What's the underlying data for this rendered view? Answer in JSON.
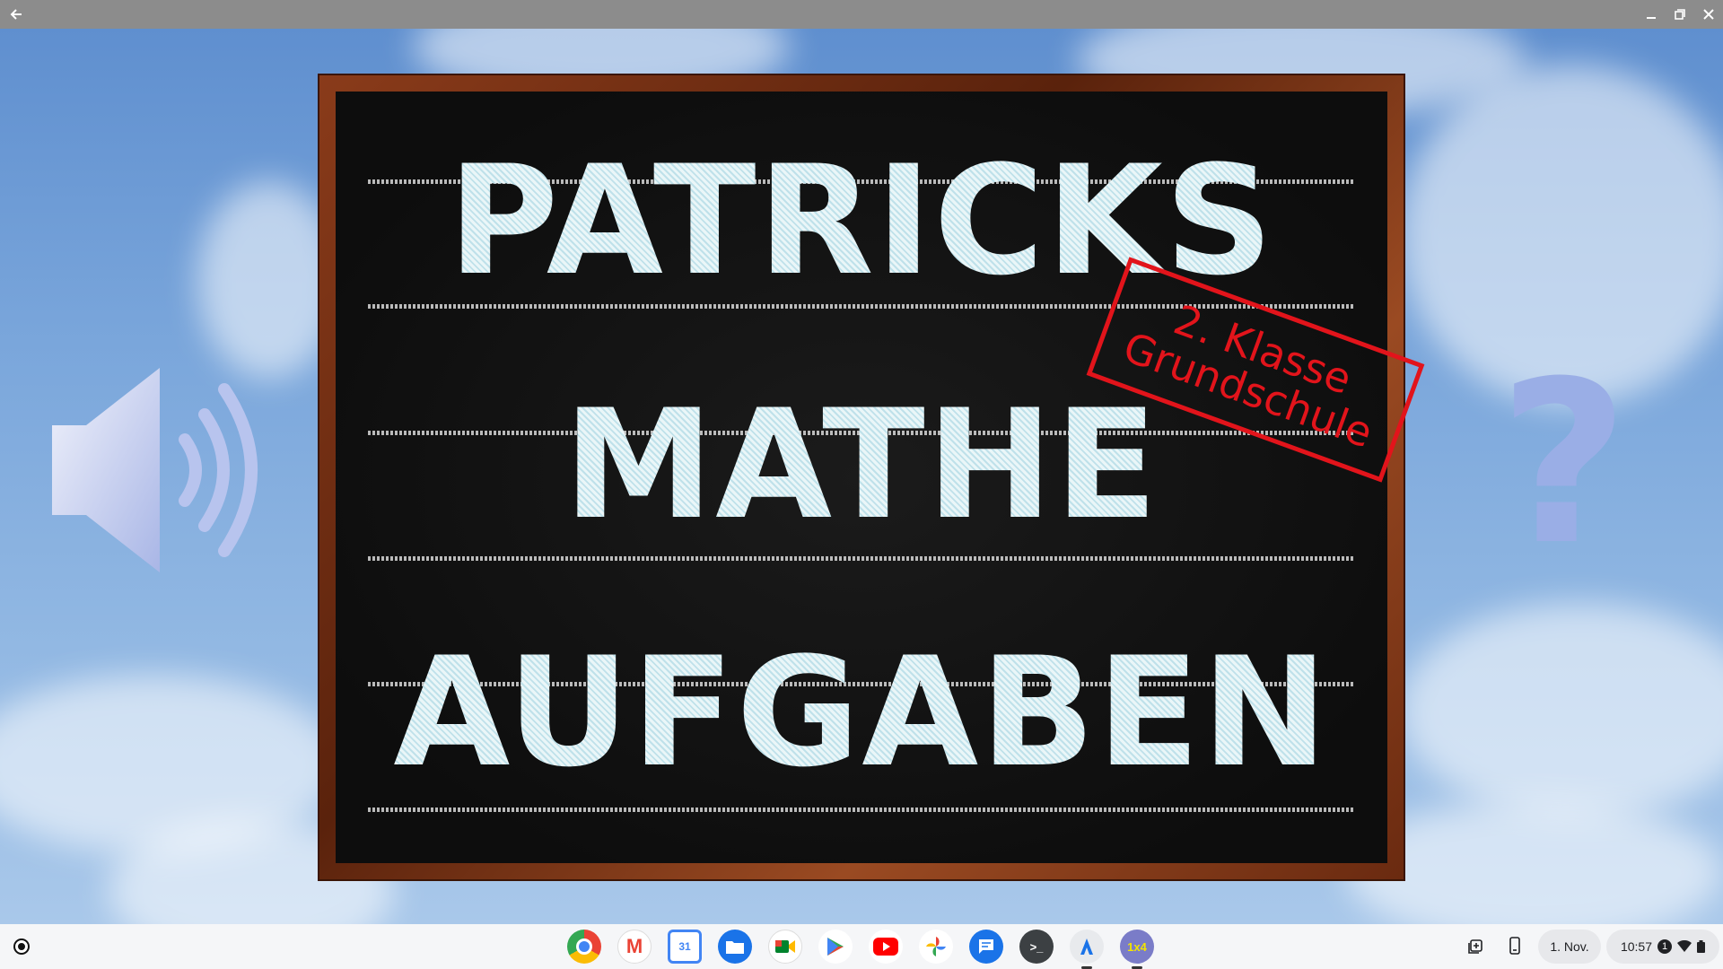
{
  "window": {
    "back_icon": "arrow-left-icon",
    "minimize_icon": "minimize-icon",
    "maximize_icon": "restore-icon",
    "close_icon": "close-icon"
  },
  "board": {
    "line1": "PATRICKS",
    "line2": "MATHE",
    "line3": "AUFGABEN",
    "stamp_line1": "2. Klasse",
    "stamp_line2": "Grundschule"
  },
  "side": {
    "speaker_icon": "speaker-icon",
    "question_mark": "?"
  },
  "shelf": {
    "launcher_icon": "launcher-icon",
    "apps": [
      {
        "name": "Chrome",
        "icon": "chrome-icon"
      },
      {
        "name": "Gmail",
        "icon": "gmail-icon",
        "label": "M"
      },
      {
        "name": "Calendar",
        "icon": "calendar-icon",
        "label": "31"
      },
      {
        "name": "Files",
        "icon": "files-icon"
      },
      {
        "name": "Meet",
        "icon": "meet-icon"
      },
      {
        "name": "Play Store",
        "icon": "play-store-icon"
      },
      {
        "name": "YouTube",
        "icon": "youtube-icon"
      },
      {
        "name": "Photos",
        "icon": "photos-icon"
      },
      {
        "name": "Messages",
        "icon": "messages-icon"
      },
      {
        "name": "Terminal",
        "icon": "terminal-icon",
        "label": ">_"
      },
      {
        "name": "App",
        "icon": "app-icon"
      },
      {
        "name": "1x4",
        "icon": "math-app-icon",
        "label": "1x4"
      }
    ],
    "date": "1. Nov.",
    "time": "10:57",
    "notification_count": "1",
    "colors": {
      "shelf_bg": "#f5f6f8",
      "stamp_red": "#e2141b",
      "chalk": "#e8f4f6"
    }
  }
}
